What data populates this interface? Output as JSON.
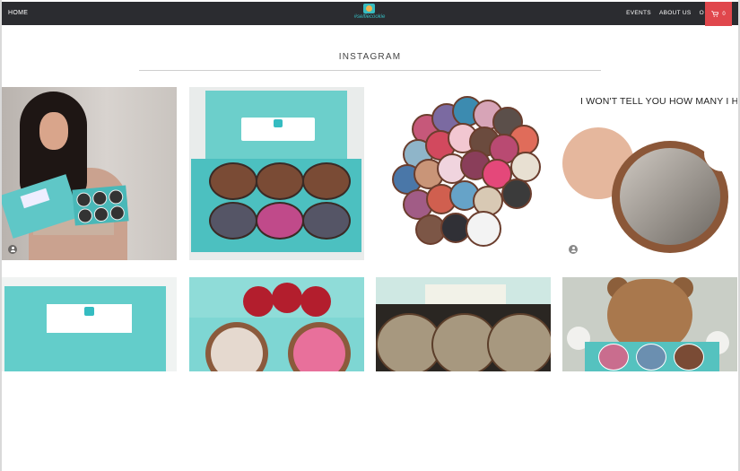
{
  "nav": {
    "home": "HOME",
    "logo": "#selfiecookie",
    "events": "EVENTS",
    "about": "ABOUT US",
    "more_truncated": "O",
    "cart_count": "0"
  },
  "section": {
    "title": "INSTAGRAM"
  },
  "posts": [
    {
      "caption": "",
      "has_user_icon": true
    },
    {
      "caption": "",
      "has_user_icon": false
    },
    {
      "caption": "",
      "has_user_icon": false
    },
    {
      "caption": "I WON'T TELL YOU HOW MANY I HAD",
      "has_user_icon": true
    },
    {
      "caption": "",
      "has_user_icon": false
    },
    {
      "caption": "",
      "has_user_icon": false
    },
    {
      "caption": "",
      "has_user_icon": false
    },
    {
      "caption": "",
      "has_user_icon": false
    }
  ],
  "colors": {
    "nav_bg": "#2b2c30",
    "cart_bg": "#e0474c",
    "brand_teal": "#35bcc1"
  },
  "icons": {
    "cart": "shopping-cart-icon",
    "user": "user-icon",
    "logo": "camera-logo-icon"
  }
}
